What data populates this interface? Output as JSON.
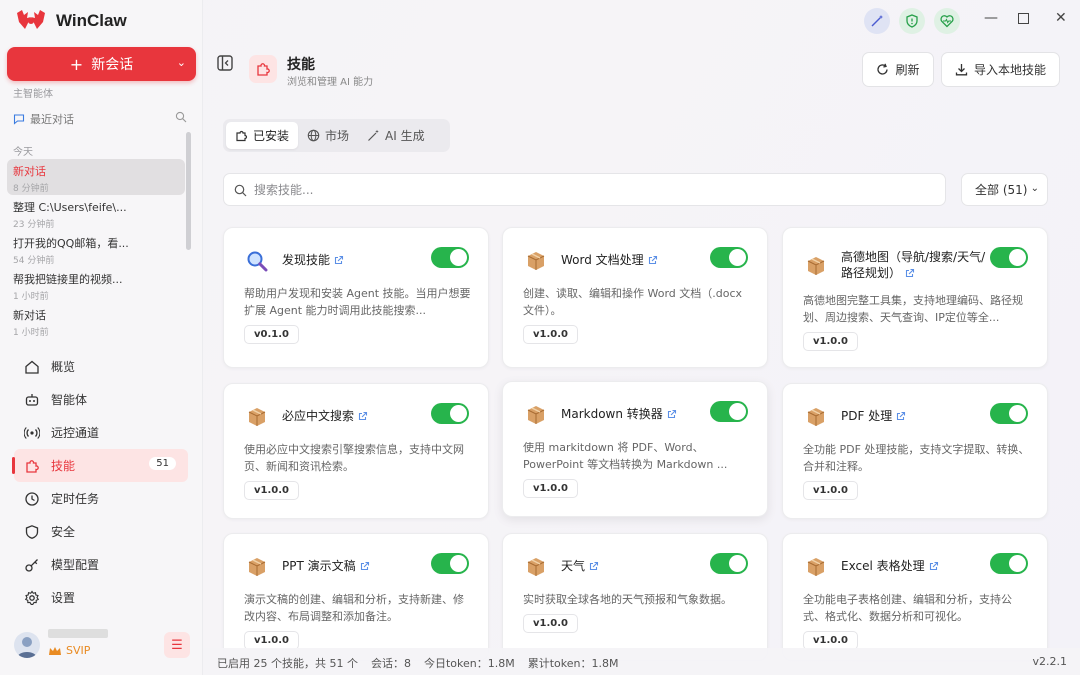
{
  "app": {
    "name": "WinClaw"
  },
  "sidebar": {
    "new_chat_label": "新会话",
    "agent_label": "主智能体",
    "recent_label": "最近对话",
    "today_label": "今天",
    "chats": [
      {
        "title": "新对话",
        "time": "8 分钟前",
        "active": true
      },
      {
        "title": "整理 C:\\Users\\feife\\...",
        "time": "23 分钟前"
      },
      {
        "title": "打开我的QQ邮箱，看...",
        "time": "54 分钟前"
      },
      {
        "title": "帮我把链接里的视频...",
        "time": "1 小时前"
      },
      {
        "title": "新对话",
        "time": "1 小时前"
      }
    ],
    "nav": [
      {
        "label": "概览",
        "icon": "home-icon"
      },
      {
        "label": "智能体",
        "icon": "robot-icon"
      },
      {
        "label": "远控通道",
        "icon": "broadcast-icon"
      },
      {
        "label": "技能",
        "icon": "puzzle-icon",
        "badge": "51",
        "active": true
      },
      {
        "label": "定时任务",
        "icon": "clock-icon"
      },
      {
        "label": "安全",
        "icon": "shield-icon"
      },
      {
        "label": "模型配置",
        "icon": "key-icon"
      },
      {
        "label": "设置",
        "icon": "gear-icon"
      }
    ],
    "user": {
      "tier": "SVIP"
    }
  },
  "header": {
    "title": "技能",
    "subtitle": "浏览和管理 AI 能力",
    "refresh_label": "刷新",
    "import_label": "导入本地技能"
  },
  "tabs": [
    {
      "label": "已安装",
      "active": true
    },
    {
      "label": "市场"
    },
    {
      "label": "AI 生成"
    }
  ],
  "search": {
    "placeholder": "搜索技能..."
  },
  "filter": {
    "label": "全部 (51)"
  },
  "skills": [
    {
      "name": "发现技能",
      "desc": "帮助用户发现和安装 Agent 技能。当用户想要扩展 Agent 能力时调用此技能搜索...",
      "version": "v0.1.0",
      "icon": "magnifier-icon",
      "enabled": true
    },
    {
      "name": "Word 文档处理",
      "desc": "创建、读取、编辑和操作 Word 文档（.docx 文件）。",
      "version": "v1.0.0",
      "icon": "package-icon",
      "enabled": true
    },
    {
      "name": "高德地图（导航/搜索/天气/路径规划）",
      "desc": "高德地图完整工具集，支持地理编码、路径规划、周边搜索、天气查询、IP定位等全...",
      "version": "v1.0.0",
      "icon": "package-icon",
      "enabled": true
    },
    {
      "name": "必应中文搜索",
      "desc": "使用必应中文搜索引擎搜索信息，支持中文网页、新闻和资讯检索。",
      "version": "v1.0.0",
      "icon": "package-icon",
      "enabled": true
    },
    {
      "name": "Markdown 转换器",
      "desc": "使用 markitdown 将 PDF、Word、PowerPoint 等文档转换为 Markdown ...",
      "version": "v1.0.0",
      "icon": "package-icon",
      "enabled": true
    },
    {
      "name": "PDF 处理",
      "desc": "全功能 PDF 处理技能，支持文字提取、转换、合并和注释。",
      "version": "v1.0.0",
      "icon": "package-icon",
      "enabled": true
    },
    {
      "name": "PPT 演示文稿",
      "desc": "演示文稿的创建、编辑和分析，支持新建、修改内容、布局调整和添加备注。",
      "version": "v1.0.0",
      "icon": "package-icon",
      "enabled": true
    },
    {
      "name": "天气",
      "desc": "实时获取全球各地的天气预报和气象数据。",
      "version": "v1.0.0",
      "icon": "package-icon",
      "enabled": true
    },
    {
      "name": "Excel 表格处理",
      "desc": "全功能电子表格创建、编辑和分析，支持公式、格式化、数据分析和可视化。",
      "version": "v1.0.0",
      "icon": "package-icon",
      "enabled": true
    }
  ],
  "statusbar": {
    "enabled": "已启用 25 个技能，共 51 个",
    "sessions": "会话：8",
    "today_token": "今日token：1.8M",
    "total_token": "累计token：1.8M",
    "version": "v2.2.1"
  },
  "colors": {
    "accent": "#e8363d",
    "toggle_on": "#27b44c",
    "svip": "#e98b23"
  }
}
